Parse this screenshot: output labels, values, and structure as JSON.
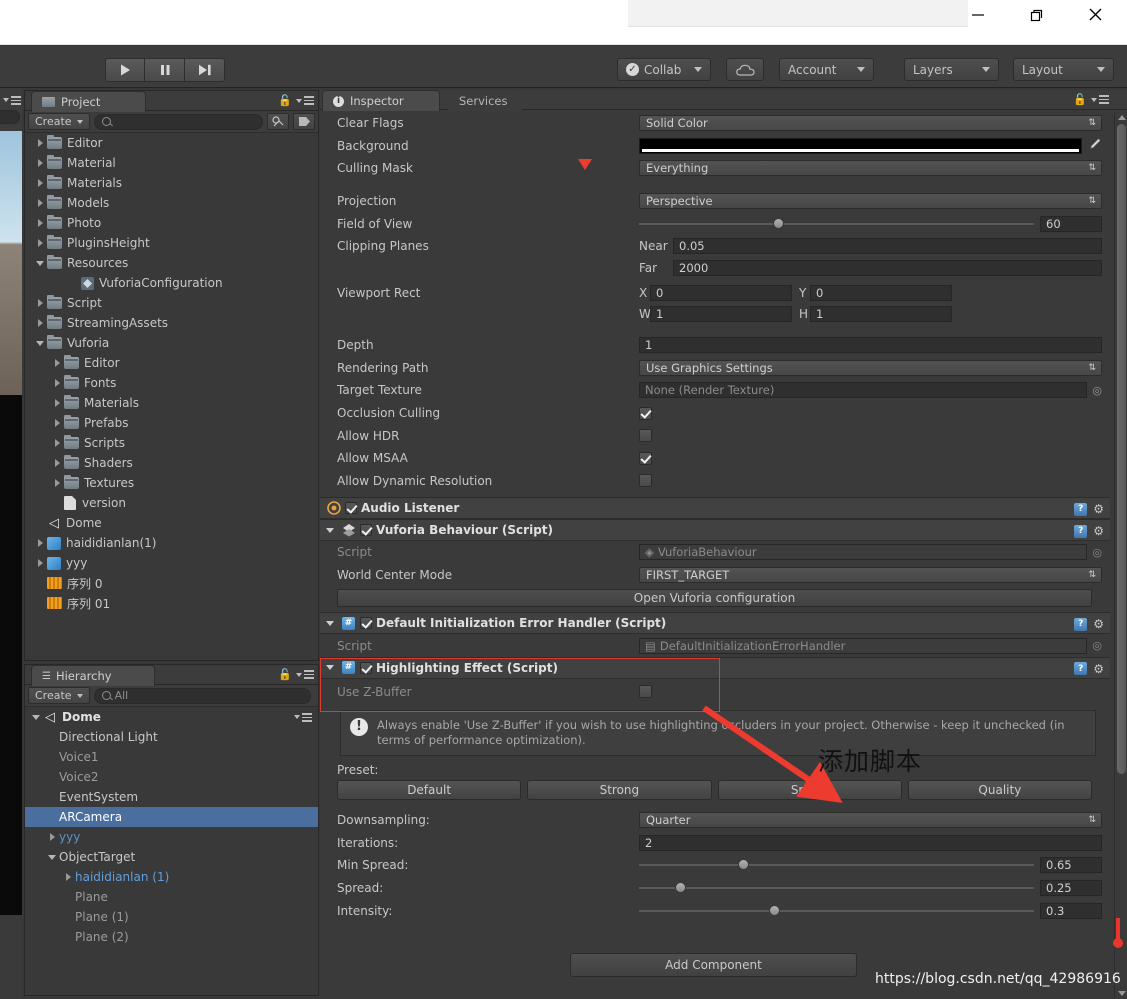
{
  "window": {
    "minimize": "minimize-icon",
    "maximize": "maximize-icon",
    "close": "close-icon"
  },
  "toolbar": {
    "play": "play-icon",
    "pause": "pause-icon",
    "step": "step-icon",
    "collab": "Collab",
    "cloud": "cloud-icon",
    "account": "Account",
    "layers": "Layers",
    "layout": "Layout"
  },
  "project": {
    "tab": "Project",
    "create": "Create",
    "search_placeholder": "",
    "items": [
      {
        "label": "Editor",
        "indent": 0,
        "arrow": "r",
        "icon": "folder"
      },
      {
        "label": "Material",
        "indent": 0,
        "arrow": "r",
        "icon": "folder"
      },
      {
        "label": "Materials",
        "indent": 0,
        "arrow": "r",
        "icon": "folder"
      },
      {
        "label": "Models",
        "indent": 0,
        "arrow": "r",
        "icon": "folder"
      },
      {
        "label": "Photo",
        "indent": 0,
        "arrow": "r",
        "icon": "folder"
      },
      {
        "label": "PluginsHeight",
        "indent": 0,
        "arrow": "r",
        "icon": "folder"
      },
      {
        "label": "Resources",
        "indent": 0,
        "arrow": "d",
        "icon": "folder"
      },
      {
        "label": "VuforiaConfiguration",
        "indent": 2,
        "arrow": "",
        "icon": "asset"
      },
      {
        "label": "Script",
        "indent": 0,
        "arrow": "r",
        "icon": "folder"
      },
      {
        "label": "StreamingAssets",
        "indent": 0,
        "arrow": "r",
        "icon": "folder"
      },
      {
        "label": "Vuforia",
        "indent": 0,
        "arrow": "d",
        "icon": "folder"
      },
      {
        "label": "Editor",
        "indent": 1,
        "arrow": "r",
        "icon": "folder"
      },
      {
        "label": "Fonts",
        "indent": 1,
        "arrow": "r",
        "icon": "folder"
      },
      {
        "label": "Materials",
        "indent": 1,
        "arrow": "r",
        "icon": "folder"
      },
      {
        "label": "Prefabs",
        "indent": 1,
        "arrow": "r",
        "icon": "folder"
      },
      {
        "label": "Scripts",
        "indent": 1,
        "arrow": "r",
        "icon": "folder"
      },
      {
        "label": "Shaders",
        "indent": 1,
        "arrow": "r",
        "icon": "folder"
      },
      {
        "label": "Textures",
        "indent": 1,
        "arrow": "r",
        "icon": "folder"
      },
      {
        "label": "version",
        "indent": 1,
        "arrow": "",
        "icon": "file"
      },
      {
        "label": "Dome",
        "indent": 0,
        "arrow": "",
        "icon": "unity"
      },
      {
        "label": "haididianlan(1)",
        "indent": 0,
        "arrow": "r",
        "icon": "prefab"
      },
      {
        "label": "yyy",
        "indent": 0,
        "arrow": "r",
        "icon": "prefab"
      },
      {
        "label": "序列 0",
        "indent": 0,
        "arrow": "",
        "icon": "audio"
      },
      {
        "label": "序列 01",
        "indent": 0,
        "arrow": "",
        "icon": "audio"
      }
    ]
  },
  "hierarchy": {
    "tab": "Hierarchy",
    "create": "Create",
    "search_value": "All",
    "items": [
      {
        "label": "Dome",
        "indent": 0,
        "arrow": "d",
        "icon": "unity",
        "style": "bold",
        "selected": false
      },
      {
        "label": "Directional Light",
        "indent": 1,
        "arrow": "",
        "icon": "",
        "style": "normal",
        "selected": false
      },
      {
        "label": "Voice1",
        "indent": 1,
        "arrow": "",
        "icon": "",
        "style": "dim",
        "selected": false
      },
      {
        "label": "Voice2",
        "indent": 1,
        "arrow": "",
        "icon": "",
        "style": "dim",
        "selected": false
      },
      {
        "label": "EventSystem",
        "indent": 1,
        "arrow": "",
        "icon": "",
        "style": "normal",
        "selected": false
      },
      {
        "label": "ARCamera",
        "indent": 1,
        "arrow": "",
        "icon": "",
        "style": "normal",
        "selected": true
      },
      {
        "label": "yyy",
        "indent": 1,
        "arrow": "r",
        "icon": "",
        "style": "prefab-dim",
        "selected": false
      },
      {
        "label": "ObjectTarget",
        "indent": 1,
        "arrow": "d",
        "icon": "",
        "style": "normal",
        "selected": false
      },
      {
        "label": "haididianlan (1)",
        "indent": 2,
        "arrow": "r",
        "icon": "",
        "style": "prefab",
        "selected": false
      },
      {
        "label": "Plane",
        "indent": 2,
        "arrow": "",
        "icon": "",
        "style": "dim",
        "selected": false
      },
      {
        "label": "Plane (1)",
        "indent": 2,
        "arrow": "",
        "icon": "",
        "style": "dim",
        "selected": false
      },
      {
        "label": "Plane (2)",
        "indent": 2,
        "arrow": "",
        "icon": "",
        "style": "dim",
        "selected": false
      }
    ]
  },
  "inspector": {
    "tab": "Inspector",
    "services_tab": "Services",
    "camera": {
      "clear_flags_label": "Clear Flags",
      "clear_flags_value": "Solid Color",
      "background_label": "Background",
      "background_color": "#000000",
      "culling_mask_label": "Culling Mask",
      "culling_mask_value": "Everything",
      "projection_label": "Projection",
      "projection_value": "Perspective",
      "fov_label": "Field of View",
      "fov_value": "60",
      "clipping_label": "Clipping Planes",
      "near_label": "Near",
      "near_value": "0.05",
      "far_label": "Far",
      "far_value": "2000",
      "viewport_label": "Viewport Rect",
      "vp_x_label": "X",
      "vp_x_value": "0",
      "vp_y_label": "Y",
      "vp_y_value": "0",
      "vp_w_label": "W",
      "vp_w_value": "1",
      "vp_h_label": "H",
      "vp_h_value": "1",
      "depth_label": "Depth",
      "depth_value": "1",
      "rendering_path_label": "Rendering Path",
      "rendering_path_value": "Use Graphics Settings",
      "target_texture_label": "Target Texture",
      "target_texture_value": "None (Render Texture)",
      "occlusion_label": "Occlusion Culling",
      "occlusion_checked": true,
      "hdr_label": "Allow HDR",
      "hdr_checked": false,
      "msaa_label": "Allow MSAA",
      "msaa_checked": true,
      "dynres_label": "Allow Dynamic Resolution",
      "dynres_checked": false
    },
    "audio_listener": {
      "title": "Audio Listener",
      "enabled": true
    },
    "vuforia": {
      "title": "Vuforia Behaviour (Script)",
      "enabled": true,
      "script_label": "Script",
      "script_value": "VuforiaBehaviour",
      "world_center_label": "World Center Mode",
      "world_center_value": "FIRST_TARGET",
      "open_config_button": "Open Vuforia configuration"
    },
    "error_handler": {
      "title": "Default Initialization Error Handler (Script)",
      "enabled": true,
      "script_label": "Script",
      "script_value": "DefaultInitializationErrorHandler"
    },
    "highlighting": {
      "title": "Highlighting Effect (Script)",
      "enabled": true,
      "zbuffer_label": "Use Z-Buffer",
      "zbuffer_checked": false,
      "help_text": "Always enable 'Use Z-Buffer' if you wish to use highlighting occluders in your project. Otherwise - keep it unchecked (in terms of performance optimization).",
      "preset_label": "Preset:",
      "presets": [
        "Default",
        "Strong",
        "Speed",
        "Quality"
      ],
      "downsampling_label": "Downsampling:",
      "downsampling_value": "Quarter",
      "iterations_label": "Iterations:",
      "iterations_value": "2",
      "min_spread_label": "Min Spread:",
      "min_spread_value": "0.65",
      "min_spread_pct": 25,
      "spread_label": "Spread:",
      "spread_value": "0.25",
      "spread_pct": 9,
      "intensity_label": "Intensity:",
      "intensity_value": "0.3",
      "intensity_pct": 33
    },
    "add_component": "Add Component"
  },
  "annotations": {
    "chinese_note": "添加脚本",
    "watermark": "https://blog.csdn.net/qq_42986916",
    "highlight_color": "#e03b2f"
  }
}
